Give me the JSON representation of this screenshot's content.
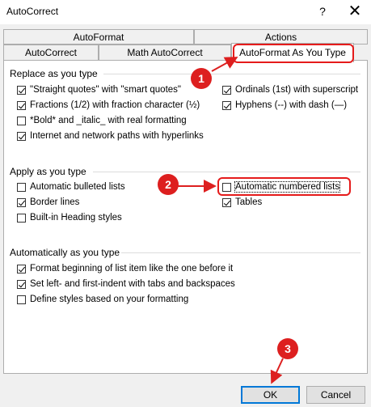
{
  "window": {
    "title": "AutoCorrect",
    "help": "?",
    "close": "✕"
  },
  "tabs": {
    "row1": [
      "AutoFormat",
      "Actions"
    ],
    "row2": [
      "AutoCorrect",
      "Math AutoCorrect",
      "AutoFormat As You Type"
    ],
    "active": "AutoFormat As You Type"
  },
  "replace": {
    "heading": "Replace as you type",
    "left": [
      {
        "label": "\"Straight quotes\" with \"smart quotes\"",
        "checked": true
      },
      {
        "label": "Fractions (1/2) with fraction character (½)",
        "checked": true
      },
      {
        "label": "*Bold* and _italic_ with real formatting",
        "checked": false
      },
      {
        "label": "Internet and network paths with hyperlinks",
        "checked": true
      }
    ],
    "right": [
      {
        "label": "Ordinals (1st) with superscript",
        "checked": true
      },
      {
        "label": "Hyphens (--) with dash (—)",
        "checked": true
      }
    ]
  },
  "apply": {
    "heading": "Apply as you type",
    "left": [
      {
        "label": "Automatic bulleted lists",
        "checked": false
      },
      {
        "label": "Border lines",
        "checked": true
      },
      {
        "label": "Built-in Heading styles",
        "checked": false
      }
    ],
    "right": [
      {
        "label": "Automatic numbered lists",
        "checked": false
      },
      {
        "label": "Tables",
        "checked": true
      }
    ]
  },
  "auto": {
    "heading": "Automatically as you type",
    "items": [
      {
        "label": "Format beginning of list item like the one before it",
        "checked": true
      },
      {
        "label": "Set left- and first-indent with tabs and backspaces",
        "checked": true
      },
      {
        "label": "Define styles based on your formatting",
        "checked": false
      }
    ]
  },
  "buttons": {
    "ok": "OK",
    "cancel": "Cancel"
  },
  "markers": [
    "1",
    "2",
    "3"
  ],
  "colors": {
    "accent": "#0078d7",
    "annotation": "#dd1f1f"
  }
}
